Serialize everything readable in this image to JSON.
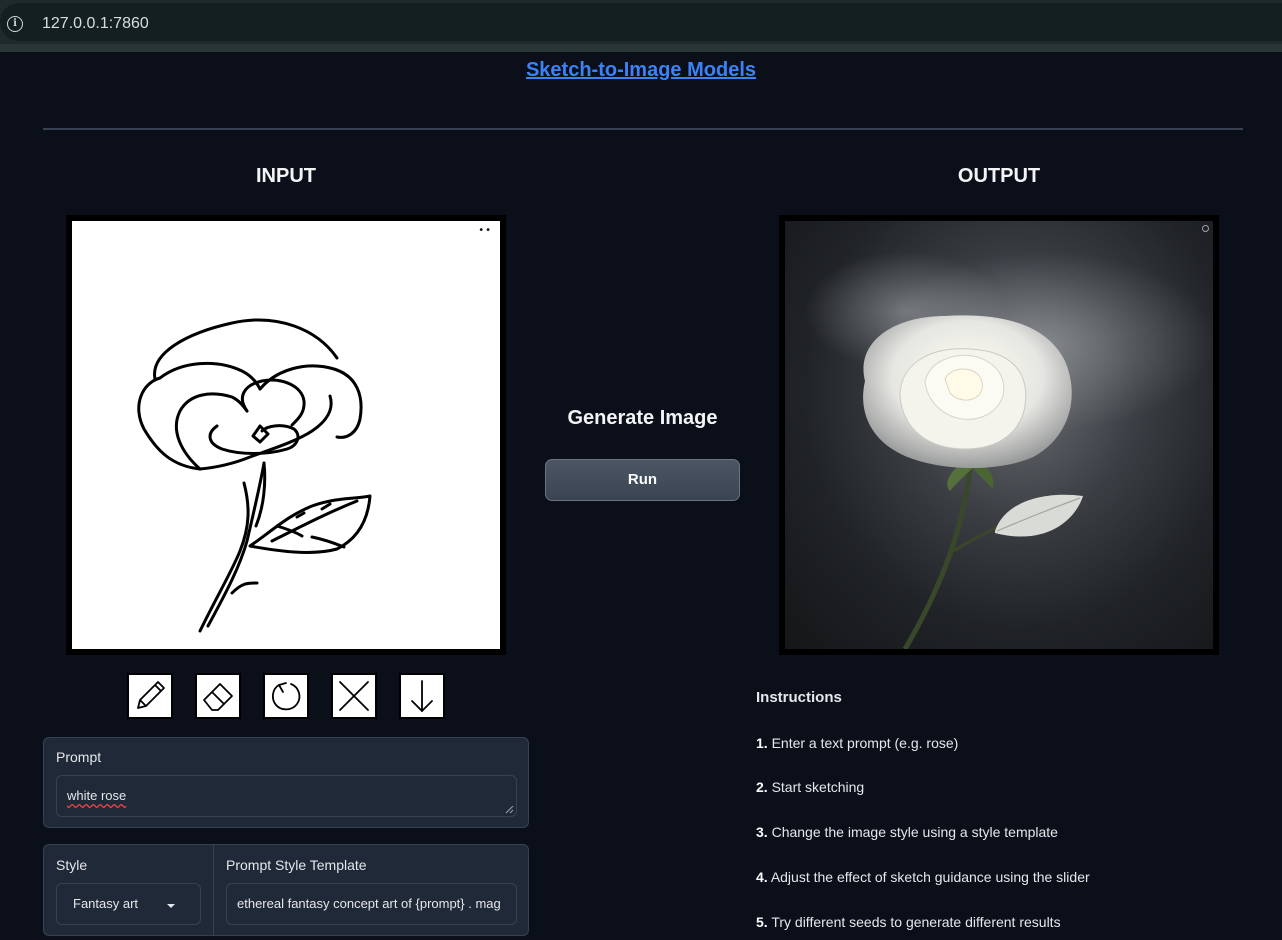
{
  "browser": {
    "url": "127.0.0.1:7860"
  },
  "header": {
    "title_link": "Sketch-to-Image Models"
  },
  "input": {
    "section_title": "INPUT",
    "canvas_menu": "••",
    "tools": [
      {
        "name": "pencil-icon"
      },
      {
        "name": "eraser-icon"
      },
      {
        "name": "undo-icon"
      },
      {
        "name": "clear-icon"
      },
      {
        "name": "download-icon"
      }
    ]
  },
  "center": {
    "generate_title": "Generate Image",
    "run_label": "Run"
  },
  "output": {
    "section_title": "OUTPUT"
  },
  "prompt": {
    "label": "Prompt",
    "value": "white rose"
  },
  "style": {
    "label": "Style",
    "selected": "Fantasy art"
  },
  "template": {
    "label": "Prompt Style Template",
    "value": "ethereal fantasy concept art of  {prompt} . mag"
  },
  "instructions": {
    "title": "Instructions",
    "steps": [
      {
        "num": "1.",
        "text": "Enter a text prompt (e.g. rose)"
      },
      {
        "num": "2.",
        "text": "Start sketching"
      },
      {
        "num": "3.",
        "text": "Change the image style using a style template"
      },
      {
        "num": "4.",
        "text": "Adjust the effect of sketch guidance using the slider"
      },
      {
        "num": "5.",
        "text": "Try different seeds to generate different results"
      }
    ]
  }
}
